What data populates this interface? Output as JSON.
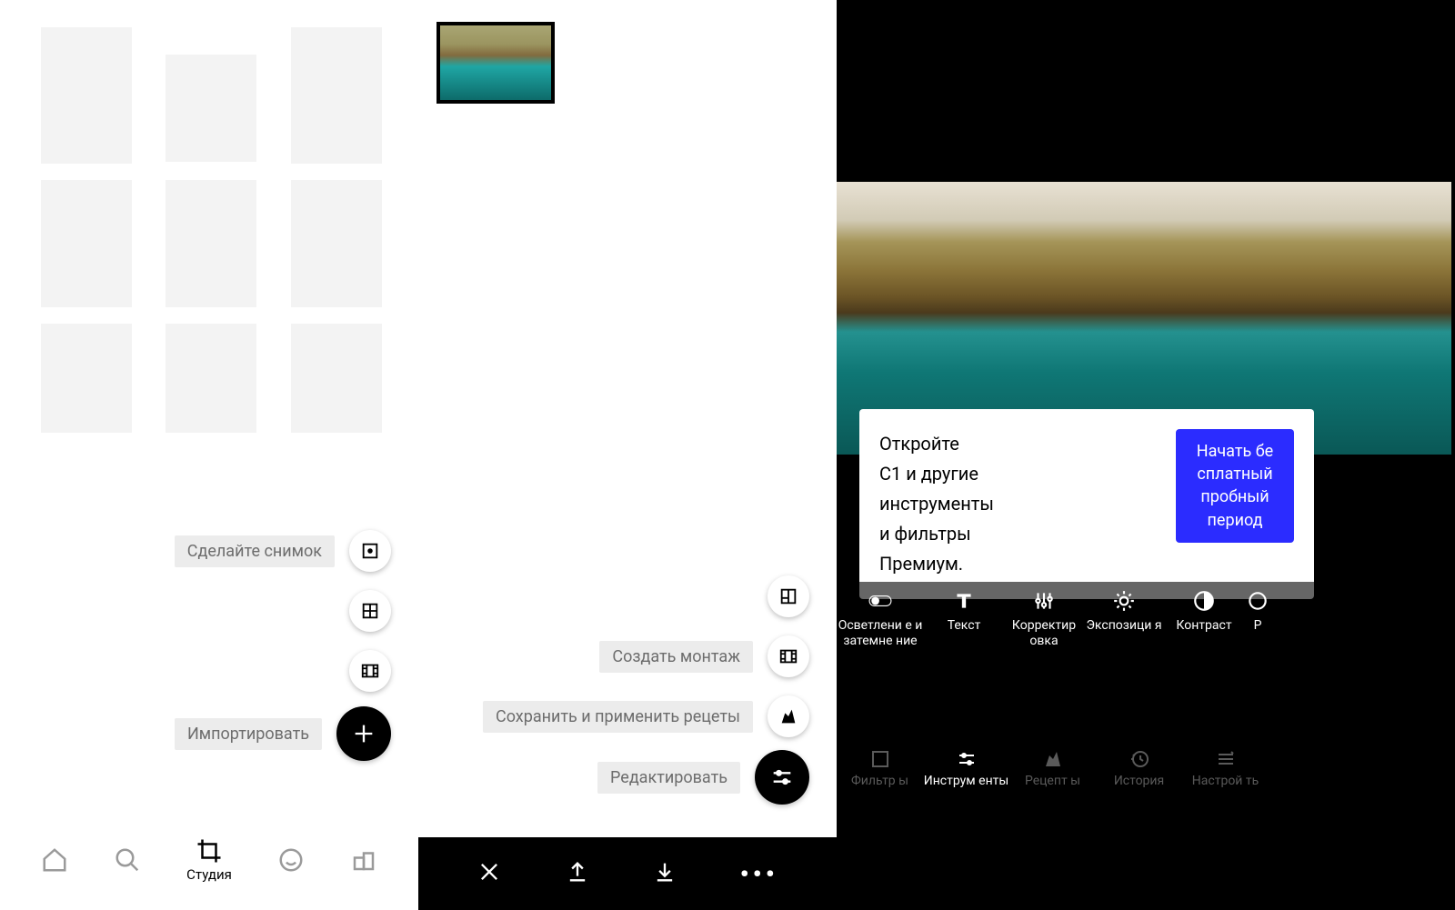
{
  "screen1": {
    "actions": {
      "take_photo": "Сделайте снимок",
      "import": "Импортировать"
    },
    "bottom_nav": {
      "studio": "Студия"
    }
  },
  "screen2": {
    "actions": {
      "create_montage": "Создать монтаж",
      "save_apply_recipes": "Сохранить и применить рецеты",
      "edit": "Редактировать"
    }
  },
  "screen3": {
    "popup": {
      "line1": "Откройте",
      "line2": "C1 и другие",
      "line3": "инструменты",
      "line4": "и фильтры",
      "line5": "Премиум.",
      "cta": "Начать бе сплатный пробный период"
    },
    "tools": {
      "dodge_burn": "Осветлени е и затемне ние",
      "text": "Текст",
      "adjust": "Корректир овка",
      "exposure": "Экспозици я",
      "contrast": "Контраст",
      "partial_r": "Р"
    },
    "bottom_nav": {
      "filters": "Фильтр ы",
      "tools": "Инструм енты",
      "recipes": "Рецепт ы",
      "history": "История",
      "settings": "Настрой ть"
    }
  }
}
